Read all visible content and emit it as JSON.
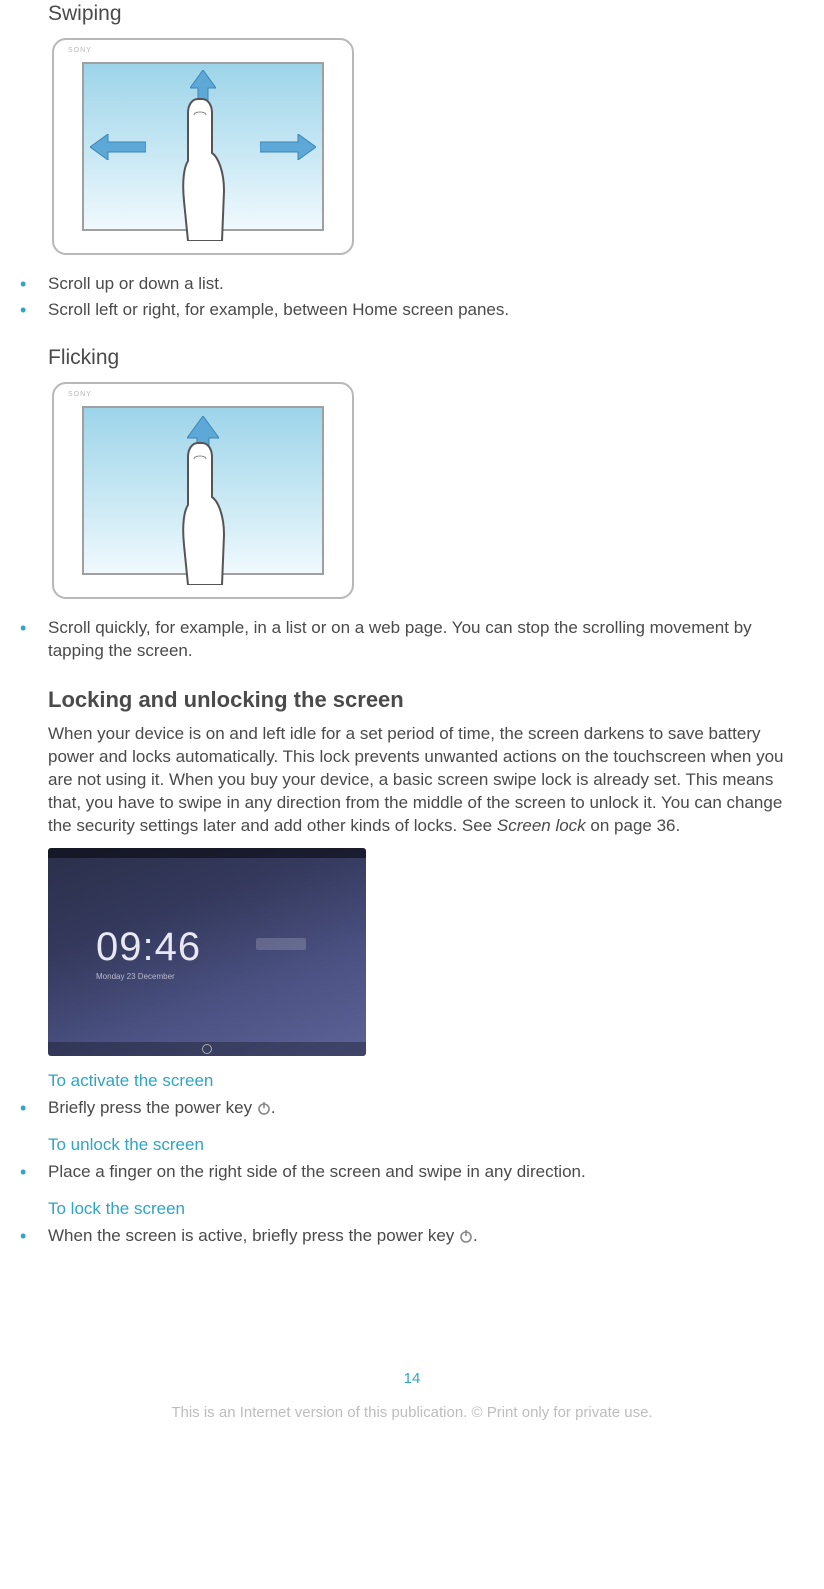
{
  "swiping": {
    "title": "Swiping",
    "brand": "SONY",
    "bullets": [
      "Scroll up or down a list.",
      "Scroll left or right, for example, between Home screen panes."
    ]
  },
  "flicking": {
    "title": "Flicking",
    "brand": "SONY",
    "bullets": [
      "Scroll quickly, for example, in a list or on a web page. You can stop the scrolling movement by tapping the screen."
    ]
  },
  "locking": {
    "title": "Locking and unlocking the screen",
    "paragraph_pre": "When your device is on and left idle for a set period of time, the screen darkens to save battery power and locks automatically. This lock prevents unwanted actions on the touchscreen when you are not using it. When you buy your device, a basic screen swipe lock is already set. This means that, you have to swipe in any direction from the middle of the screen to unlock it. You can change the security settings later and add other kinds of locks. See ",
    "paragraph_link": "Screen lock",
    "paragraph_post": " on page 36.",
    "clock_time": "09:46",
    "clock_date": "Monday 23 December"
  },
  "activate": {
    "title": "To activate the screen",
    "bullet_pre": "Briefly press the power key ",
    "bullet_post": "."
  },
  "unlock": {
    "title": "To unlock the screen",
    "bullet": "Place a finger on the right side of the screen and swipe in any direction."
  },
  "lock": {
    "title": "To lock the screen",
    "bullet_pre": "When the screen is active, briefly press the power key ",
    "bullet_post": "."
  },
  "footer": {
    "page": "14",
    "text": "This is an Internet version of this publication. © Print only for private use."
  }
}
